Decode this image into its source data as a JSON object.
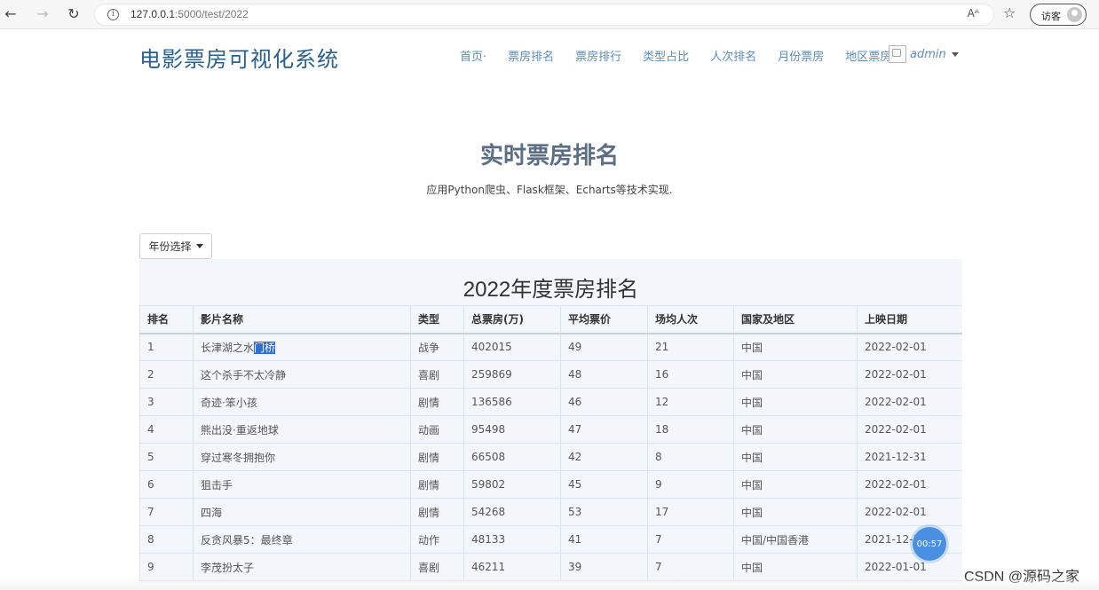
{
  "browser": {
    "url_host": "127.0.0.1",
    "url_path": ":5000/test/2022",
    "reader_label": "Aᴬ",
    "guest_label": "访客"
  },
  "site": {
    "title": "电影票房可视化系统",
    "nav": [
      "首页·",
      "票房排名",
      "票房排行",
      "类型占比",
      "人次排名",
      "月份票房",
      "地区票房"
    ],
    "user": "admin"
  },
  "hero": {
    "title": "实时票房排名",
    "subtitle": "应用Python爬虫、Flask框架、Echarts等技术实现."
  },
  "year_select": {
    "label": "年份选择"
  },
  "table": {
    "title": "2022年度票房排名",
    "headers": [
      "排名",
      "影片名称",
      "类型",
      "总票房(万)",
      "平均票价",
      "场均人次",
      "国家及地区",
      "上映日期"
    ],
    "rows": [
      [
        "1",
        "长津湖之水门桥",
        "战争",
        "402015",
        "49",
        "21",
        "中国",
        "2022-02-01"
      ],
      [
        "2",
        "这个杀手不太冷静",
        "喜剧",
        "259869",
        "48",
        "16",
        "中国",
        "2022-02-01"
      ],
      [
        "3",
        "奇迹·笨小孩",
        "剧情",
        "136586",
        "46",
        "12",
        "中国",
        "2022-02-01"
      ],
      [
        "4",
        "熊出没·重返地球",
        "动画",
        "95498",
        "47",
        "18",
        "中国",
        "2022-02-01"
      ],
      [
        "5",
        "穿过寒冬拥抱你",
        "剧情",
        "66508",
        "42",
        "8",
        "中国",
        "2021-12-31"
      ],
      [
        "6",
        "狙击手",
        "剧情",
        "59802",
        "45",
        "9",
        "中国",
        "2022-02-01"
      ],
      [
        "7",
        "四海",
        "剧情",
        "54268",
        "53",
        "17",
        "中国",
        "2022-02-01"
      ],
      [
        "8",
        "反贪风暴5：最终章",
        "动作",
        "48133",
        "41",
        "7",
        "中国/中国香港",
        "2021-12-3"
      ],
      [
        "9",
        "李茂扮太子",
        "喜剧",
        "46211",
        "39",
        "7",
        "中国",
        "2022-01-01"
      ]
    ]
  },
  "timer": "00:57",
  "watermark": "CSDN @源码之家",
  "colors": {
    "title": "#2b5f8c",
    "nav": "#5d8db7",
    "hero": "#5b6e83",
    "timer": "#4a90e2"
  }
}
